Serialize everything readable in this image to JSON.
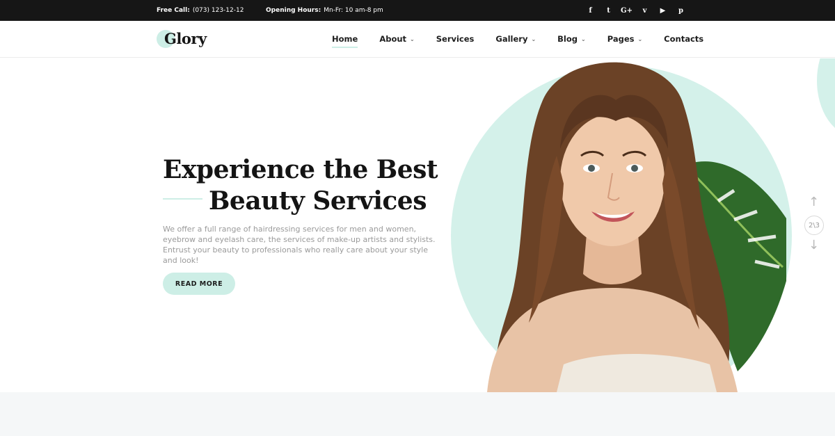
{
  "topbar": {
    "free_call_label": "Free Call:",
    "free_call_value": "(073) 123-12-12",
    "hours_label": "Opening Hours:",
    "hours_value": "Mn-Fr: 10 am-8 pm",
    "social": [
      {
        "icon": "facebook-icon",
        "glyph": "f"
      },
      {
        "icon": "twitter-icon",
        "glyph": "t"
      },
      {
        "icon": "google-plus-icon",
        "glyph": "G+"
      },
      {
        "icon": "vimeo-icon",
        "glyph": "v"
      },
      {
        "icon": "youtube-icon",
        "glyph": "▶"
      },
      {
        "icon": "pinterest-icon",
        "glyph": "p"
      }
    ]
  },
  "header": {
    "logo": "Glory",
    "nav": [
      {
        "label": "Home",
        "active": true,
        "dropdown": false
      },
      {
        "label": "About",
        "active": false,
        "dropdown": true
      },
      {
        "label": "Services",
        "active": false,
        "dropdown": false
      },
      {
        "label": "Gallery",
        "active": false,
        "dropdown": true
      },
      {
        "label": "Blog",
        "active": false,
        "dropdown": true
      },
      {
        "label": "Pages",
        "active": false,
        "dropdown": true
      },
      {
        "label": "Contacts",
        "active": false,
        "dropdown": false
      }
    ]
  },
  "hero": {
    "headline_line1": "Experience the Best",
    "headline_line2": "Beauty Services",
    "description": "We offer a full range of hairdressing services for men and women, eyebrow and eyelash care, the services of make-up artists and stylists. Entrust your beauty to professionals who really care about your style and look!",
    "button_label": "READ MORE",
    "slide_counter": "2\\3"
  },
  "colors": {
    "accent": "#cdeee6",
    "topbar_bg": "#161616",
    "text_dark": "#141414",
    "text_muted": "#9a9a9a"
  }
}
